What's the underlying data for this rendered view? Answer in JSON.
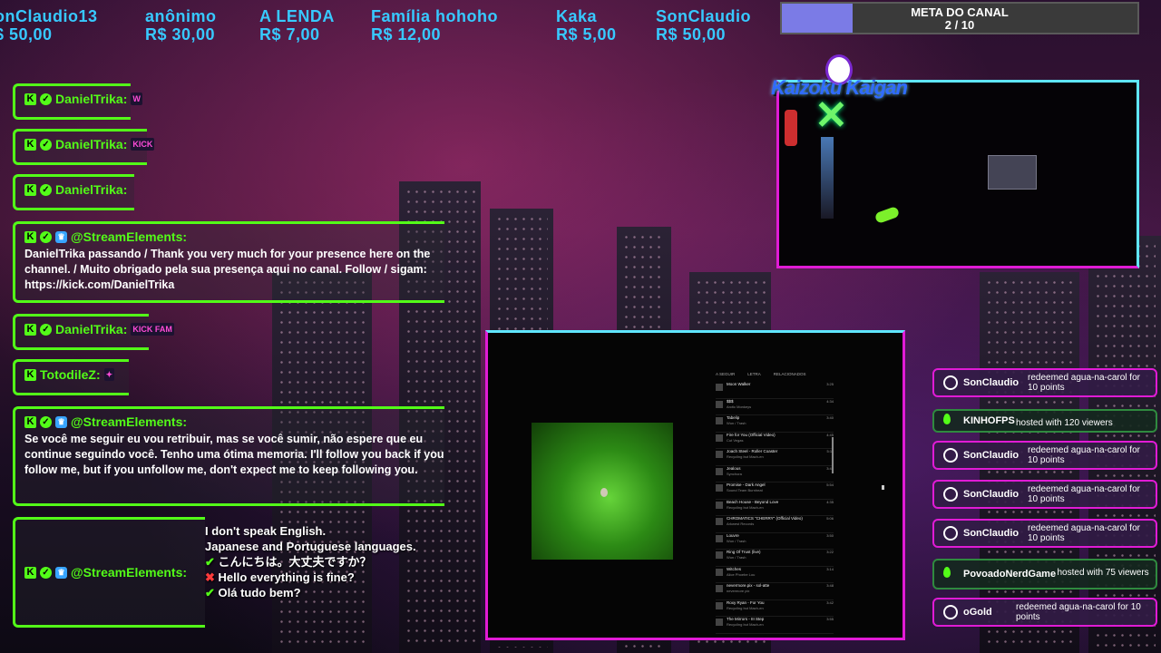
{
  "donations": [
    {
      "name": "onClaudio13",
      "amount": "$ 50,00"
    },
    {
      "name": "anônimo",
      "amount": "R$ 30,00"
    },
    {
      "name": "A LENDA",
      "amount": "R$ 7,00"
    },
    {
      "name": "Família hohoho",
      "amount": "R$ 12,00"
    },
    {
      "name": "Kaka",
      "amount": "R$ 5,00"
    },
    {
      "name": "SonClaudio",
      "amount": "R$ 50,00"
    }
  ],
  "goal": {
    "title": "META DO CANAL",
    "progress": "2  /  10",
    "current": 2,
    "target": 10
  },
  "logo": {
    "text": "Kaizoku Kaigan"
  },
  "chat": [
    {
      "user": "DanielTrika:",
      "badges": [
        "kick",
        "verified"
      ],
      "emote": "W",
      "text": ""
    },
    {
      "user": "DanielTrika:",
      "badges": [
        "kick",
        "verified"
      ],
      "emote": "KICK",
      "text": ""
    },
    {
      "user": "DanielTrika:",
      "badges": [
        "kick",
        "verified"
      ],
      "emote": "",
      "text": ""
    },
    {
      "user": "@StreamElements:",
      "badges": [
        "kick",
        "verified",
        "mod"
      ],
      "emote": "",
      "text": "DanielTrika passando / Thank you very much for your presence here on the channel. / Muito obrigado pela sua presença aqui no canal. Follow / sigam: https://kick.com/DanielTrika"
    },
    {
      "user": "DanielTrika:",
      "badges": [
        "kick",
        "verified"
      ],
      "emote": "KICK FAM",
      "text": ""
    },
    {
      "user": "TotodileZ:",
      "badges": [
        "kick"
      ],
      "emote": "✦",
      "text": ""
    },
    {
      "user": "@StreamElements:",
      "badges": [
        "kick",
        "verified",
        "mod"
      ],
      "emote": "",
      "text": "Se você me seguir eu vou retribuir, mas se você sumir, não espere que eu continue seguindo você. Tenho uma ótima memoria. I'll follow you back if you follow me, but if you unfollow me, don't expect me to keep following you."
    },
    {
      "user": "@StreamElements:",
      "badges": [
        "kick",
        "verified",
        "mod"
      ],
      "emote": "",
      "text": ""
    }
  ],
  "speech": {
    "line1": "I don't speak English.",
    "line2": "Japanese and Portuguese languages.",
    "line3": "こんにちは。大丈夫ですか？",
    "line4": "Hello everything is fine?",
    "line5": "Olá tudo bem?"
  },
  "events": [
    {
      "type": "redeem",
      "user": "SonClaudio",
      "action": "redeemed agua-na-carol for 10 points"
    },
    {
      "type": "host",
      "user": "KINHOFPS",
      "action": "hosted with 120 viewers"
    },
    {
      "type": "redeem",
      "user": "SonClaudio",
      "action": "redeemed agua-na-carol for 10 points"
    },
    {
      "type": "redeem",
      "user": "SonClaudio",
      "action": "redeemed agua-na-carol for 10 points"
    },
    {
      "type": "redeem",
      "user": "SonClaudio",
      "action": "redeemed agua-na-carol for 10 points"
    },
    {
      "type": "host",
      "user": "PovoadoNerdGame",
      "action": "hosted with 75 viewers"
    },
    {
      "type": "redeem",
      "user": "oGold",
      "action": "redeemed agua-na-carol for 10 points"
    }
  ],
  "playlist": {
    "tabs": [
      "A SEGUIR",
      "LETRA",
      "RELACIONADOS"
    ],
    "items": [
      {
        "title": "Moon Walker",
        "artist": "",
        "duration": "3:25"
      },
      {
        "title": "$$$",
        "artist": "Arctic Monkeys",
        "duration": "4:34"
      },
      {
        "title": "Tabelip",
        "artist": "Wun / Trash",
        "duration": "3:40"
      },
      {
        "title": "Fire for You (Official Video)",
        "artist": "Cut Vegas",
        "duration": "4:45"
      },
      {
        "title": "Joach Steel - Roller Coaster",
        "artist": "Recycling but Mach-en",
        "duration": "5:11"
      },
      {
        "title": "Jealous",
        "artist": "Synchora",
        "duration": "3:49"
      },
      {
        "title": "Promise - Dark Angel",
        "artist": "Sound Team Burnheat",
        "duration": "5:54"
      },
      {
        "title": "Beach House - Beyond Love",
        "artist": "Recycling but Mach-en",
        "duration": "4:35"
      },
      {
        "title": "CHROMATICS \"CHERRY\" (Official Video)",
        "artist": "Arkwest Records",
        "duration": "5:06"
      },
      {
        "title": "Louvre",
        "artist": "Wun / Trash",
        "duration": "3:50"
      },
      {
        "title": "Ring Of Trust (live)",
        "artist": "Wun / Trash",
        "duration": "3:22"
      },
      {
        "title": "Witches",
        "artist": "Alice Phoebe Lou",
        "duration": "3:14"
      },
      {
        "title": "nevermore.pix - sol-atte",
        "artist": "nevermore pix",
        "duration": "3:48"
      },
      {
        "title": "Roxy Ryan - For You",
        "artist": "Recycling but Mach-en",
        "duration": "3:42"
      },
      {
        "title": "The Mirrors - III Step",
        "artist": "Recycling but Mach-en",
        "duration": "3:55"
      }
    ]
  },
  "colors": {
    "kick_green": "#53fc18",
    "panel_border": "#e01bd5",
    "panel_top": "#5fe6ff",
    "donor_text": "#37c9ff"
  }
}
